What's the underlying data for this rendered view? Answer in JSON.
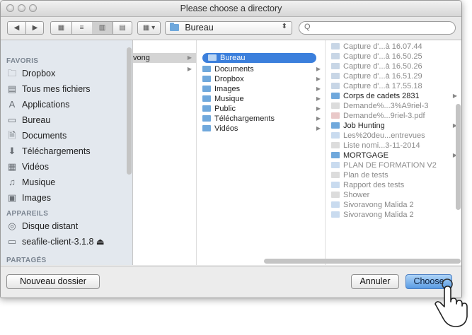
{
  "window": {
    "title": "Please choose a directory"
  },
  "toolbar": {
    "back_glyph": "◀",
    "forward_glyph": "▶",
    "path_label": "Bureau",
    "search_glyph": "Q"
  },
  "sidebar": {
    "favorites_header": "FAVORIS",
    "favorites": [
      {
        "label": "Dropbox",
        "icon": "folder-icon"
      },
      {
        "label": "Tous mes fichiers",
        "icon": "all-files-icon"
      },
      {
        "label": "Applications",
        "icon": "applications-icon"
      },
      {
        "label": "Bureau",
        "icon": "desktop-icon"
      },
      {
        "label": "Documents",
        "icon": "documents-icon"
      },
      {
        "label": "Téléchargements",
        "icon": "downloads-icon"
      },
      {
        "label": "Vidéos",
        "icon": "movies-icon"
      },
      {
        "label": "Musique",
        "icon": "music-icon"
      },
      {
        "label": "Images",
        "icon": "pictures-icon"
      }
    ],
    "devices_header": "APPAREILS",
    "devices": [
      {
        "label": "Disque distant",
        "icon": "remote-disk-icon"
      },
      {
        "label": "seafile-client-3.1.8 ⏏",
        "icon": "drive-icon"
      }
    ],
    "shared_header": "PARTAGÉS"
  },
  "columns": {
    "col1": [
      "vong"
    ],
    "col2": [
      "Bureau",
      "Documents",
      "Dropbox",
      "Images",
      "Musique",
      "Public",
      "Téléchargements",
      "Vidéos"
    ],
    "col3": [
      {
        "label": "Capture d'...à 16.07.44",
        "kind": "image",
        "folder": false
      },
      {
        "label": "Capture d'...à 16.50.25",
        "kind": "image",
        "folder": false
      },
      {
        "label": "Capture d'...à 16.50.26",
        "kind": "image",
        "folder": false
      },
      {
        "label": "Capture d'...à 16.51.29",
        "kind": "image",
        "folder": false
      },
      {
        "label": "Capture d'...à 17.55.18",
        "kind": "image",
        "folder": false
      },
      {
        "label": "Corps de cadets 2831",
        "kind": "folder",
        "folder": true
      },
      {
        "label": "Demande%...3%A9riel-3",
        "kind": "file",
        "folder": false
      },
      {
        "label": "Demande%...9riel-3.pdf",
        "kind": "pdf",
        "folder": false
      },
      {
        "label": "Job Hunting",
        "kind": "folder",
        "folder": true
      },
      {
        "label": "Les%20deu...entrevues",
        "kind": "file",
        "folder": false
      },
      {
        "label": "Liste nomi...3-11-2014",
        "kind": "file",
        "folder": false
      },
      {
        "label": "MORTGAGE",
        "kind": "folder",
        "folder": true
      },
      {
        "label": "PLAN DE FORMATION V2",
        "kind": "file",
        "folder": false
      },
      {
        "label": "Plan de tests",
        "kind": "file",
        "folder": false
      },
      {
        "label": "Rapport des tests",
        "kind": "file",
        "folder": false
      },
      {
        "label": "Shower",
        "kind": "file",
        "folder": false
      },
      {
        "label": "Sivoravong Malida 2",
        "kind": "file",
        "folder": false
      },
      {
        "label": "Sivoravong Malida 2",
        "kind": "file",
        "folder": false
      }
    ]
  },
  "footer": {
    "new_folder_label": "Nouveau dossier",
    "cancel_label": "Annuler",
    "choose_label": "Choose"
  },
  "colors": {
    "selection": "#3b7fdc",
    "folder": "#6fa8dc",
    "sidebar_bg": "#e3e8ee"
  }
}
